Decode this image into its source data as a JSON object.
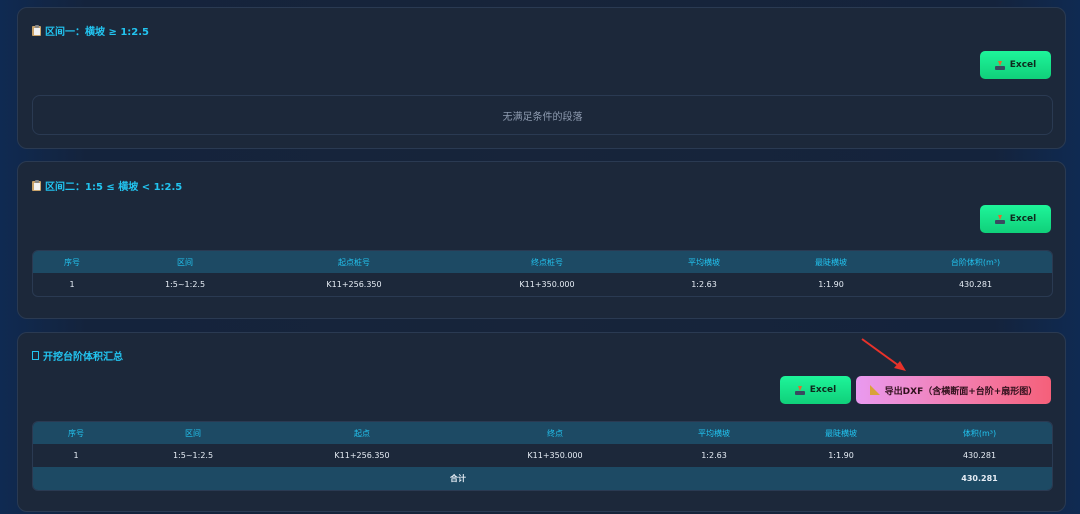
{
  "section1": {
    "title": "区间一：横坡 ≥ 1:2.5",
    "excel_label": "Excel",
    "empty_text": "无满足条件的段落"
  },
  "section2": {
    "title": "区间二：1:5 ≤ 横坡 < 1:2.5",
    "excel_label": "Excel",
    "headers": [
      "序号",
      "区间",
      "起点桩号",
      "终点桩号",
      "平均横坡",
      "最陡横坡",
      "台阶体积(m³)"
    ],
    "rows": [
      [
        "1",
        "1:5~1:2.5",
        "K11+256.350",
        "K11+350.000",
        "1:2.63",
        "1:1.90",
        "430.281"
      ]
    ]
  },
  "section3": {
    "title": "开挖台阶体积汇总",
    "excel_label": "Excel",
    "dxf_label": "导出DXF（含横断面+台阶+扇形图）",
    "headers": [
      "序号",
      "区间",
      "起点",
      "终点",
      "平均横坡",
      "最陡横坡",
      "体积(m³)"
    ],
    "rows": [
      [
        "1",
        "1:5~1:2.5",
        "K11+256.350",
        "K11+350.000",
        "1:2.63",
        "1:1.90",
        "430.281"
      ]
    ],
    "total_label": "合计",
    "total_value": "430.281"
  },
  "colors": {
    "accent": "#22c4f0",
    "excel_button": "#1ef59a",
    "dxf_button_start": "#e99af0",
    "dxf_button_end": "#f5607a",
    "annotation_arrow": "#e8322a"
  }
}
